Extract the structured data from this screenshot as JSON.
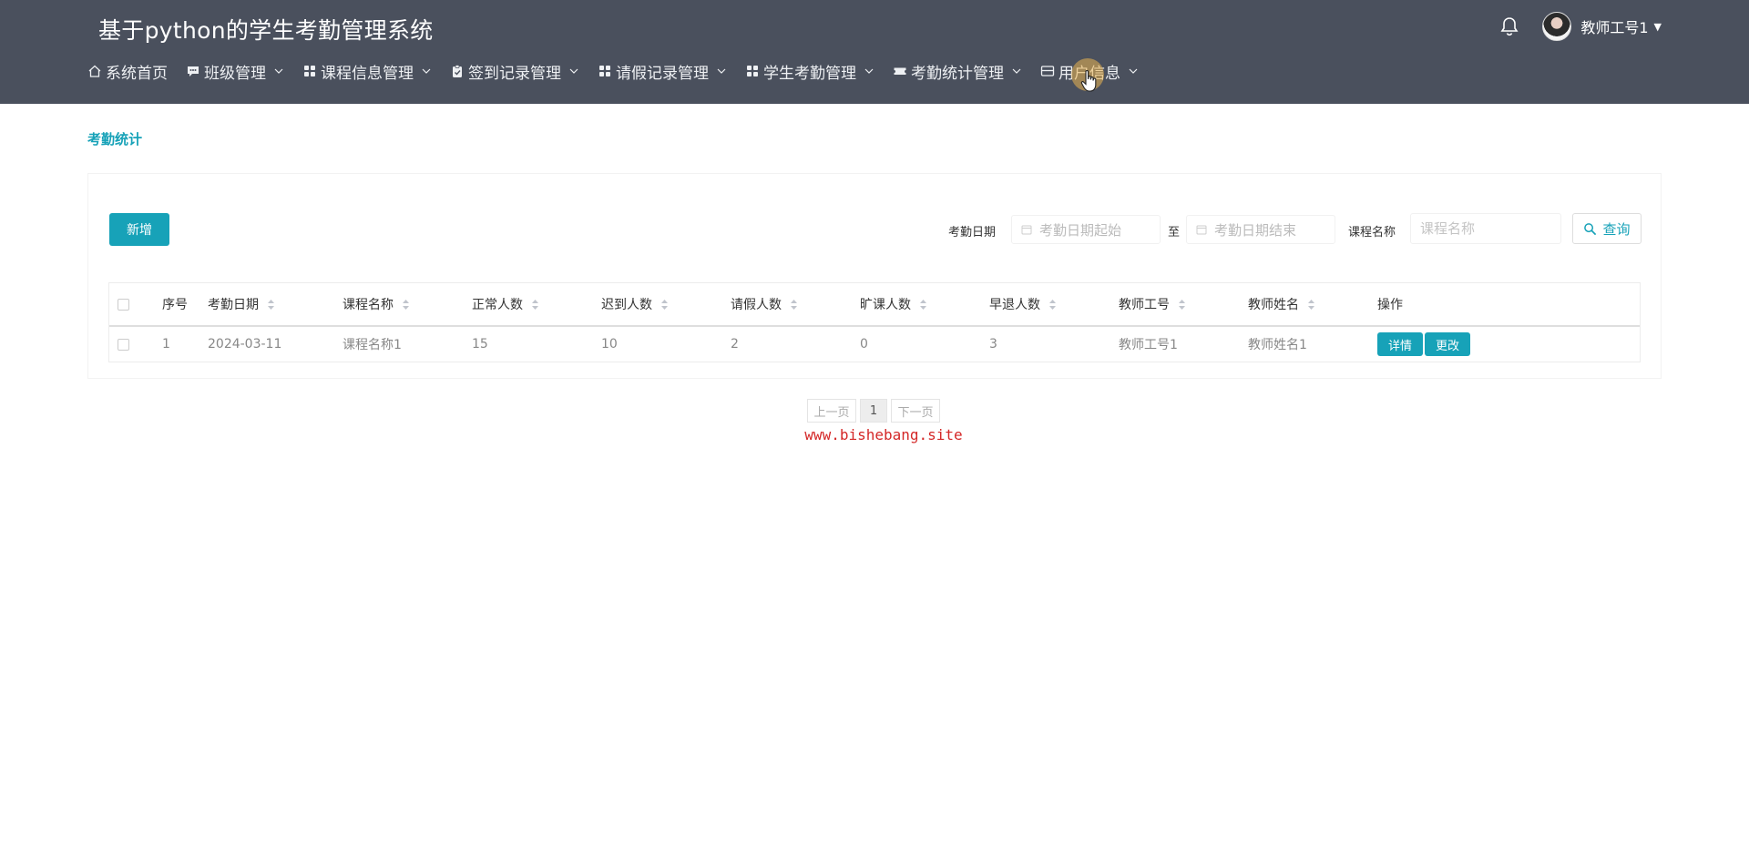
{
  "app": {
    "title": "基于python的学生考勤管理系统"
  },
  "user": {
    "name": "教师工号1"
  },
  "nav": [
    {
      "label": "系统首页",
      "icon": "home-icon",
      "dropdown": false
    },
    {
      "label": "班级管理",
      "icon": "chat-icon",
      "dropdown": true
    },
    {
      "label": "课程信息管理",
      "icon": "grid-icon",
      "dropdown": true
    },
    {
      "label": "签到记录管理",
      "icon": "clipboard-check-icon",
      "dropdown": true
    },
    {
      "label": "请假记录管理",
      "icon": "grid-icon",
      "dropdown": true
    },
    {
      "label": "学生考勤管理",
      "icon": "grid-icon",
      "dropdown": true
    },
    {
      "label": "考勤统计管理",
      "icon": "ticket-icon",
      "dropdown": true
    },
    {
      "label": "用户信息",
      "icon": "id-card-icon",
      "dropdown": true
    }
  ],
  "breadcrumb": "考勤统计",
  "toolbar": {
    "add_label": "新增"
  },
  "filters": {
    "date_label": "考勤日期",
    "date_start_placeholder": "考勤日期起始",
    "to_label": "至",
    "date_end_placeholder": "考勤日期结束",
    "course_label": "课程名称",
    "course_placeholder": "课程名称",
    "search_label": "查询"
  },
  "table": {
    "headers": [
      "序号",
      "考勤日期",
      "课程名称",
      "正常人数",
      "迟到人数",
      "请假人数",
      "旷课人数",
      "早退人数",
      "教师工号",
      "教师姓名",
      "操作"
    ],
    "rows": [
      [
        "1",
        "2024-03-11",
        "课程名称1",
        "15",
        "10",
        "2",
        "0",
        "3",
        "教师工号1",
        "教师姓名1"
      ]
    ],
    "actions": [
      "详情",
      "更改"
    ]
  },
  "pagination": {
    "prev": "上一页",
    "current": "1",
    "next": "下一页"
  },
  "watermark": "www.bishebang.site",
  "colors": {
    "header_bg": "#4a505d",
    "accent": "#17a2b8",
    "watermark": "#d42828"
  }
}
